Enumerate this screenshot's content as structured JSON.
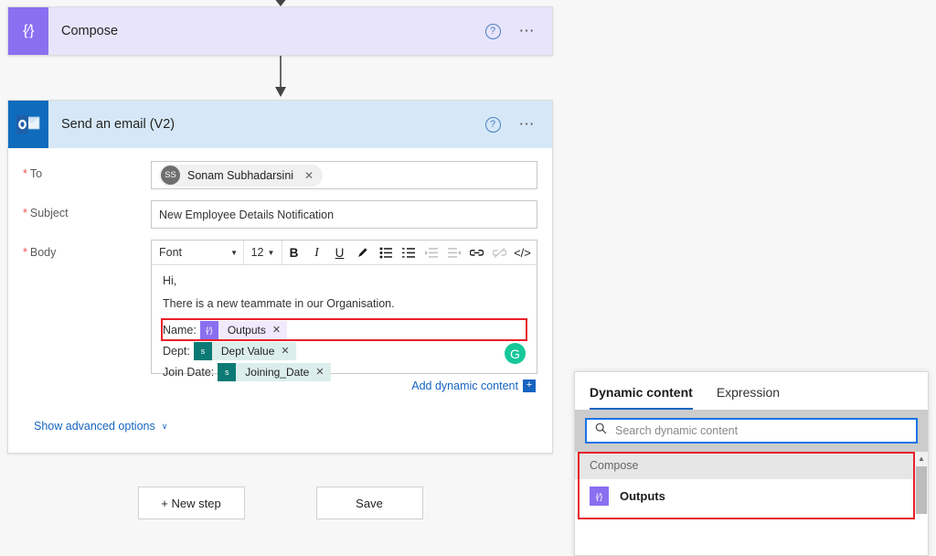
{
  "flow": {
    "compose_card": {
      "title": "Compose",
      "icon": "compose-braces-icon",
      "help_icon": "help-circle-icon",
      "menu_icon": "ellipsis-icon"
    },
    "email_card": {
      "title": "Send an email (V2)",
      "icon": "outlook-icon",
      "help_icon": "help-circle-icon",
      "menu_icon": "ellipsis-icon"
    },
    "fields": {
      "to": {
        "label": "To",
        "required": "*",
        "recipient": "Sonam Subhadarsini",
        "initials": "SS",
        "remove": "✕"
      },
      "subject": {
        "label": "Subject",
        "required": "*",
        "value": "New Employee Details Notification"
      },
      "body": {
        "label": "Body",
        "required": "*"
      }
    },
    "toolbar": {
      "font_label": "Font",
      "font_size": "12",
      "bold": "B",
      "italic": "I",
      "underline": "U",
      "highlight_icon": "pen-icon",
      "bullet_list_icon": "bulleted-list-icon",
      "number_list_icon": "numbered-list-icon",
      "indent_decrease_icon": "indent-decrease-icon",
      "indent_increase_icon": "indent-increase-icon",
      "link_icon": "link-icon",
      "unlink_icon": "unlink-icon",
      "code_icon": "</>"
    },
    "body_content": {
      "greeting": "Hi,",
      "intro": "There is a new teammate in our Organisation.",
      "rows": [
        {
          "label": "Name:",
          "token": "Outputs",
          "token_icon": "compose-braces-icon",
          "icon_glyph": "{⁄}",
          "kind": "compose",
          "highlighted": true,
          "remove": "✕"
        },
        {
          "label": "Dept:",
          "token": "Dept Value",
          "token_icon": "sharepoint-icon",
          "icon_glyph": "s",
          "kind": "sharepoint",
          "highlighted": false,
          "remove": "✕"
        },
        {
          "label": "Join Date:",
          "token": "Joining_Date",
          "token_icon": "sharepoint-icon",
          "icon_glyph": "s",
          "kind": "sharepoint",
          "highlighted": false,
          "remove": "✕"
        }
      ],
      "grammarly_icon": "G"
    },
    "add_dynamic_content": {
      "label": "Add dynamic content",
      "plus": "+"
    },
    "show_advanced": {
      "label": "Show advanced options",
      "caret": "∨"
    }
  },
  "footer": {
    "new_step": "+ New step",
    "save": "Save"
  },
  "dynamic_panel": {
    "tabs": [
      {
        "label": "Dynamic content",
        "active": true
      },
      {
        "label": "Expression",
        "active": false
      }
    ],
    "search": {
      "placeholder": "Search dynamic content",
      "value": "",
      "icon": "search-icon"
    },
    "groups": [
      {
        "name": "Compose",
        "items": [
          {
            "label": "Outputs",
            "icon": "compose-braces-icon",
            "glyph": "{⁄}"
          }
        ]
      }
    ],
    "scroll_up_icon": "▲"
  },
  "colors": {
    "compose_purple": "#8a6ff0",
    "compose_header": "#e8e4fb",
    "outlook_blue": "#0f6cbd",
    "email_header": "#d6e8f7",
    "sharepoint_teal": "#0b7a74",
    "link_blue": "#1664c0",
    "highlight_red": "#e8202a",
    "grammarly_green": "#16c79a",
    "required_red": "#e8554f"
  }
}
